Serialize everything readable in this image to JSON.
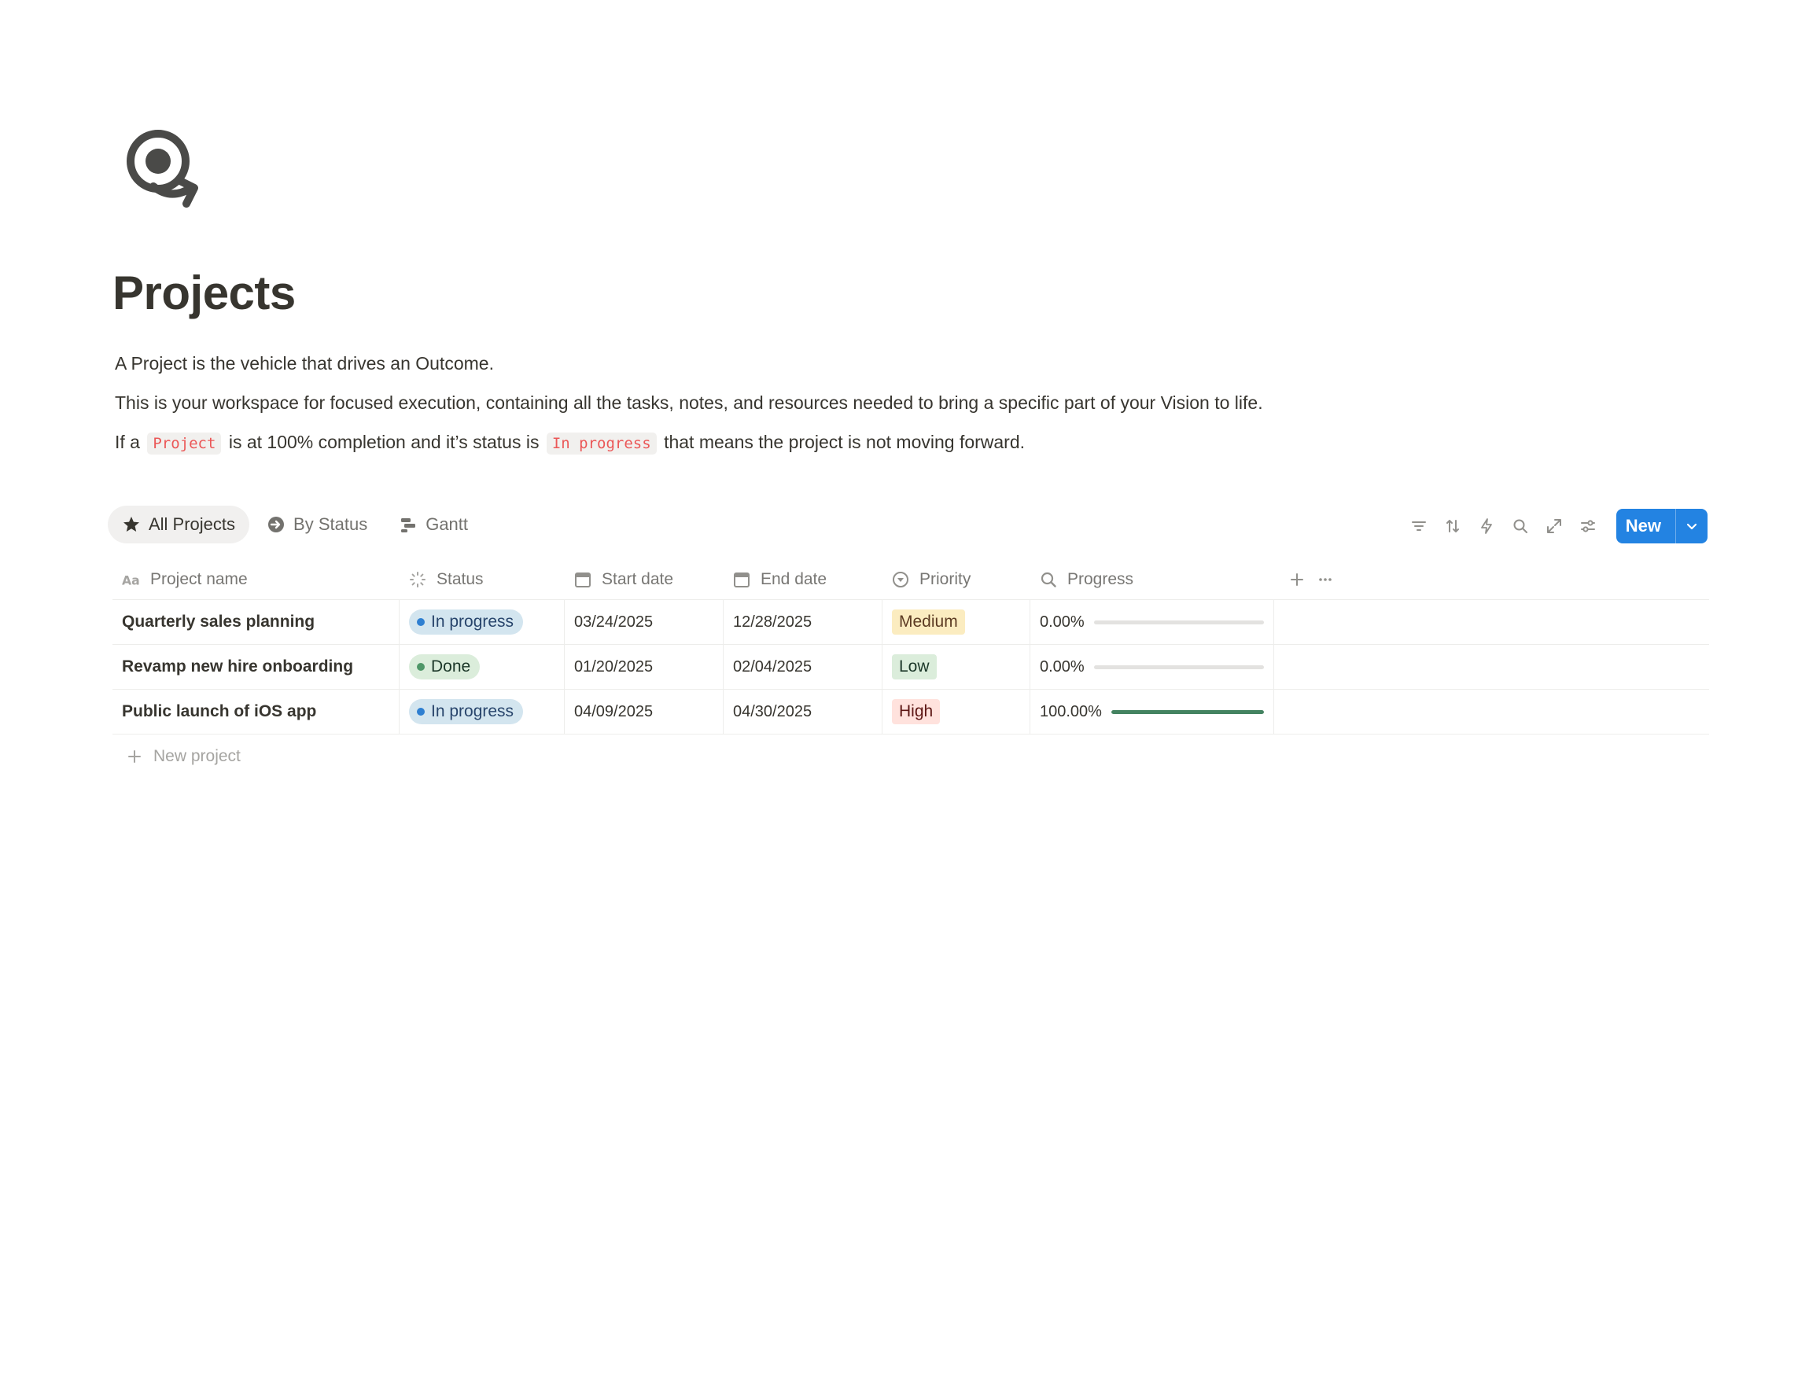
{
  "page": {
    "icon": "target-arrow-icon",
    "title": "Projects",
    "desc1": "A Project is the vehicle that drives an Outcome.",
    "desc2": "This is your workspace for focused execution, containing all the tasks, notes, and resources needed to bring a specific part of your Vision to life.",
    "desc3": {
      "pre": "If a",
      "code1": "Project",
      "mid": "is at 100% completion and it’s status is",
      "code2": "In progress",
      "post": "that means the project is not moving forward."
    }
  },
  "views": [
    {
      "label": "All Projects",
      "icon": "star-icon",
      "active": true
    },
    {
      "label": "By Status",
      "icon": "arrow-circle-icon",
      "active": false
    },
    {
      "label": "Gantt",
      "icon": "timeline-icon",
      "active": false
    }
  ],
  "toolbar": {
    "icons": [
      "filter-icon",
      "sort-icon",
      "lightning-icon",
      "search-icon",
      "expand-icon",
      "settings-icon"
    ],
    "new_label": "New"
  },
  "table": {
    "columns": [
      {
        "label": "Project name",
        "icon": "text-aa-icon"
      },
      {
        "label": "Status",
        "icon": "status-spinner-icon"
      },
      {
        "label": "Start date",
        "icon": "calendar-icon"
      },
      {
        "label": "End date",
        "icon": "calendar-icon"
      },
      {
        "label": "Priority",
        "icon": "select-circle-icon"
      },
      {
        "label": "Progress",
        "icon": "search-icon"
      }
    ],
    "rows": [
      {
        "name": "Quarterly sales planning",
        "status": "In progress",
        "start": "03/24/2025",
        "end": "12/28/2025",
        "priority": "Medium",
        "progress": "0.00%",
        "progress_value": 0
      },
      {
        "name": "Revamp new hire onboarding",
        "status": "Done",
        "start": "01/20/2025",
        "end": "02/04/2025",
        "priority": "Low",
        "progress": "0.00%",
        "progress_value": 0
      },
      {
        "name": "Public launch of iOS app",
        "status": "In progress",
        "start": "04/09/2025",
        "end": "04/30/2025",
        "priority": "High",
        "progress": "100.00%",
        "progress_value": 1
      }
    ],
    "new_row_label": "New project"
  },
  "colors": {
    "status": {
      "In progress": {
        "bg": "#d3e5ef",
        "dot": "#2e7fd1",
        "text": "#28456c"
      },
      "Done": {
        "bg": "#dbeddb",
        "dot": "#4f9768",
        "text": "#1c3829"
      }
    },
    "priority": {
      "Medium": {
        "bg": "#fbecc0",
        "text": "#5c3b23"
      },
      "Low": {
        "bg": "#dbeddb",
        "text": "#1c3829"
      },
      "High": {
        "bg": "#ffe2dd",
        "text": "#5d1715"
      }
    },
    "progress_fill": "#448361",
    "accent": "#2383e2"
  }
}
